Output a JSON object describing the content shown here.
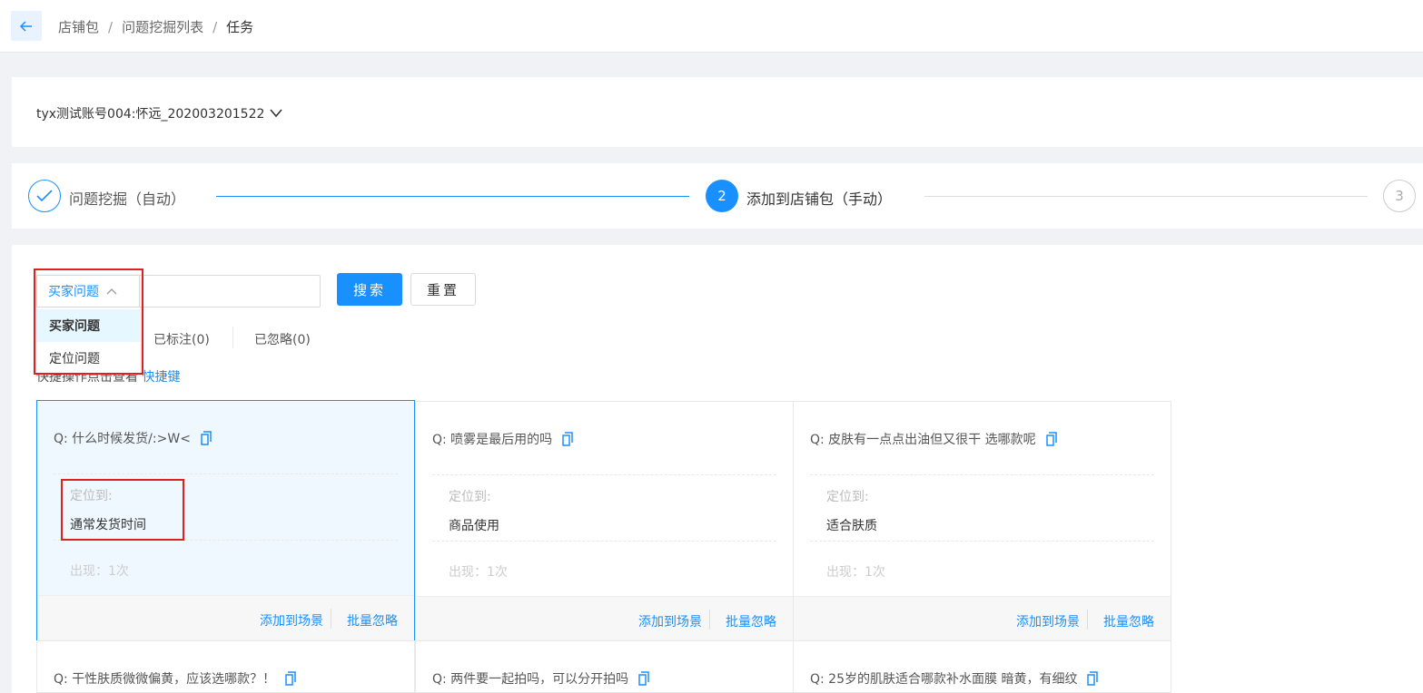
{
  "breadcrumb": [
    "店铺包",
    "问题挖掘列表",
    "任务"
  ],
  "account": "tyx测试账号004:怀远_202003201522",
  "steps": [
    {
      "number": "",
      "label": "问题挖掘（自动）",
      "state": "done"
    },
    {
      "number": "2",
      "label": "添加到店铺包（手动）",
      "state": "active"
    },
    {
      "number": "3",
      "label": "",
      "state": "pending"
    }
  ],
  "search": {
    "select_value": "买家问题",
    "placeholder": "",
    "search_label": "搜索",
    "reset_label": "重置"
  },
  "dropdown": {
    "options": [
      "买家问题",
      "定位问题"
    ],
    "selected": "买家问题"
  },
  "tabs": {
    "marked": "已标注(0)",
    "ignored": "已忽略(0)"
  },
  "hint": {
    "text": "快捷操作点击查看",
    "link": "快捷键"
  },
  "cards": [
    {
      "q": "Q: 什么时候发货/:>W<",
      "loc_label": "定位到:",
      "loc": "通常发货时间",
      "appear": "出现：1次",
      "add": "添加到场景",
      "ignore": "批量忽略"
    },
    {
      "q": "Q: 喷雾是最后用的吗",
      "loc_label": "定位到:",
      "loc": "商品使用",
      "appear": "出现：1次",
      "add": "添加到场景",
      "ignore": "批量忽略"
    },
    {
      "q": "Q: 皮肤有一点点出油但又很干 选哪款呢",
      "loc_label": "定位到:",
      "loc": "适合肤质",
      "appear": "出现：1次",
      "add": "添加到场景",
      "ignore": "批量忽略"
    },
    {
      "q": "Q: 干性肤质微微偏黄，应该选哪款？！"
    },
    {
      "q": "Q: 两件要一起拍吗，可以分开拍吗"
    },
    {
      "q": "Q: 25岁的肌肤适合哪款补水面膜 暗黄，有细纹"
    }
  ],
  "colors": {
    "primary": "#1890ff",
    "highlight": "#e02020"
  }
}
